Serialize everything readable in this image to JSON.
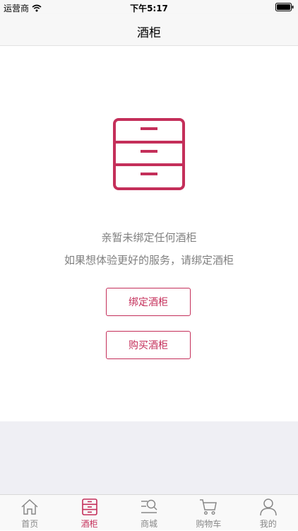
{
  "status_bar": {
    "carrier": "运营商",
    "time": "下午5:17"
  },
  "nav": {
    "title": "酒柜"
  },
  "empty_state": {
    "line1": "亲暂未绑定任何酒柜",
    "line2": "如果想体验更好的服务，请绑定酒柜"
  },
  "actions": {
    "bind_label": "绑定酒柜",
    "buy_label": "购买酒柜"
  },
  "tabs": [
    {
      "label": "首页",
      "icon": "home-icon",
      "active": false
    },
    {
      "label": "酒柜",
      "icon": "cabinet-icon",
      "active": true
    },
    {
      "label": "商城",
      "icon": "mall-search-icon",
      "active": false
    },
    {
      "label": "购物车",
      "icon": "cart-icon",
      "active": false
    },
    {
      "label": "我的",
      "icon": "user-icon",
      "active": false
    }
  ],
  "colors": {
    "accent": "#c42f5a",
    "inactive": "#888888",
    "text_gray": "#808080",
    "footer_bg": "#efeff4"
  }
}
